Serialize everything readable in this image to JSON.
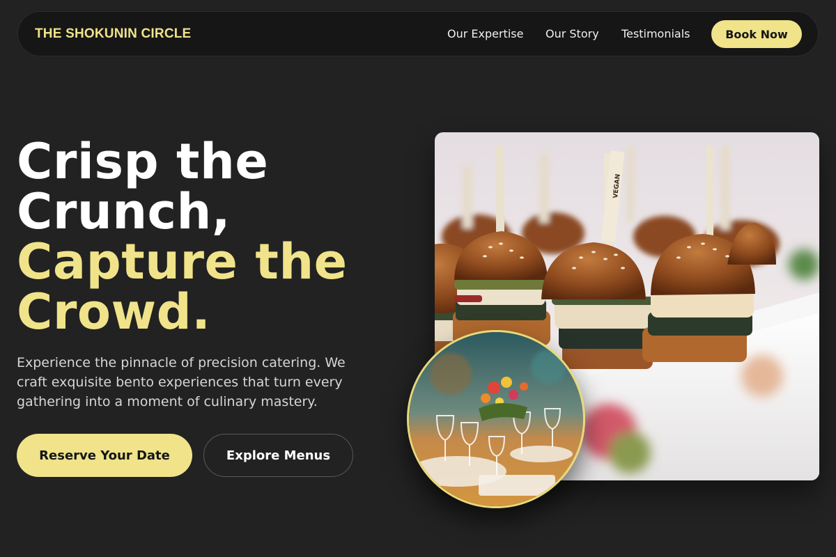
{
  "brand": {
    "name": "THE SHOKUNIN CIRCLE"
  },
  "nav": {
    "links": [
      "Our Expertise",
      "Our Story",
      "Testimonials"
    ],
    "cta_label": "Book Now"
  },
  "hero": {
    "headline_white_1": "Crisp the",
    "headline_white_2": "Crunch,",
    "headline_gold_1": "Capture the",
    "headline_gold_2": "Crowd.",
    "subtext": "Experience the pinnacle of precision catering. We craft exquisite bento experiences that turn every gathering into a moment of culinary mastery.",
    "primary_cta": "Reserve Your Date",
    "secondary_cta": "Explore Menus"
  },
  "images": {
    "main": "photo of gourmet slider burgers on skewers, one skewer labeled",
    "main_skewer_label": "VEGAN",
    "circle": "photo of an elegant banquet table with glassware and floral centerpiece"
  },
  "colors": {
    "background": "#222222",
    "accent": "#f0e38a",
    "nav_background": "#161616"
  }
}
